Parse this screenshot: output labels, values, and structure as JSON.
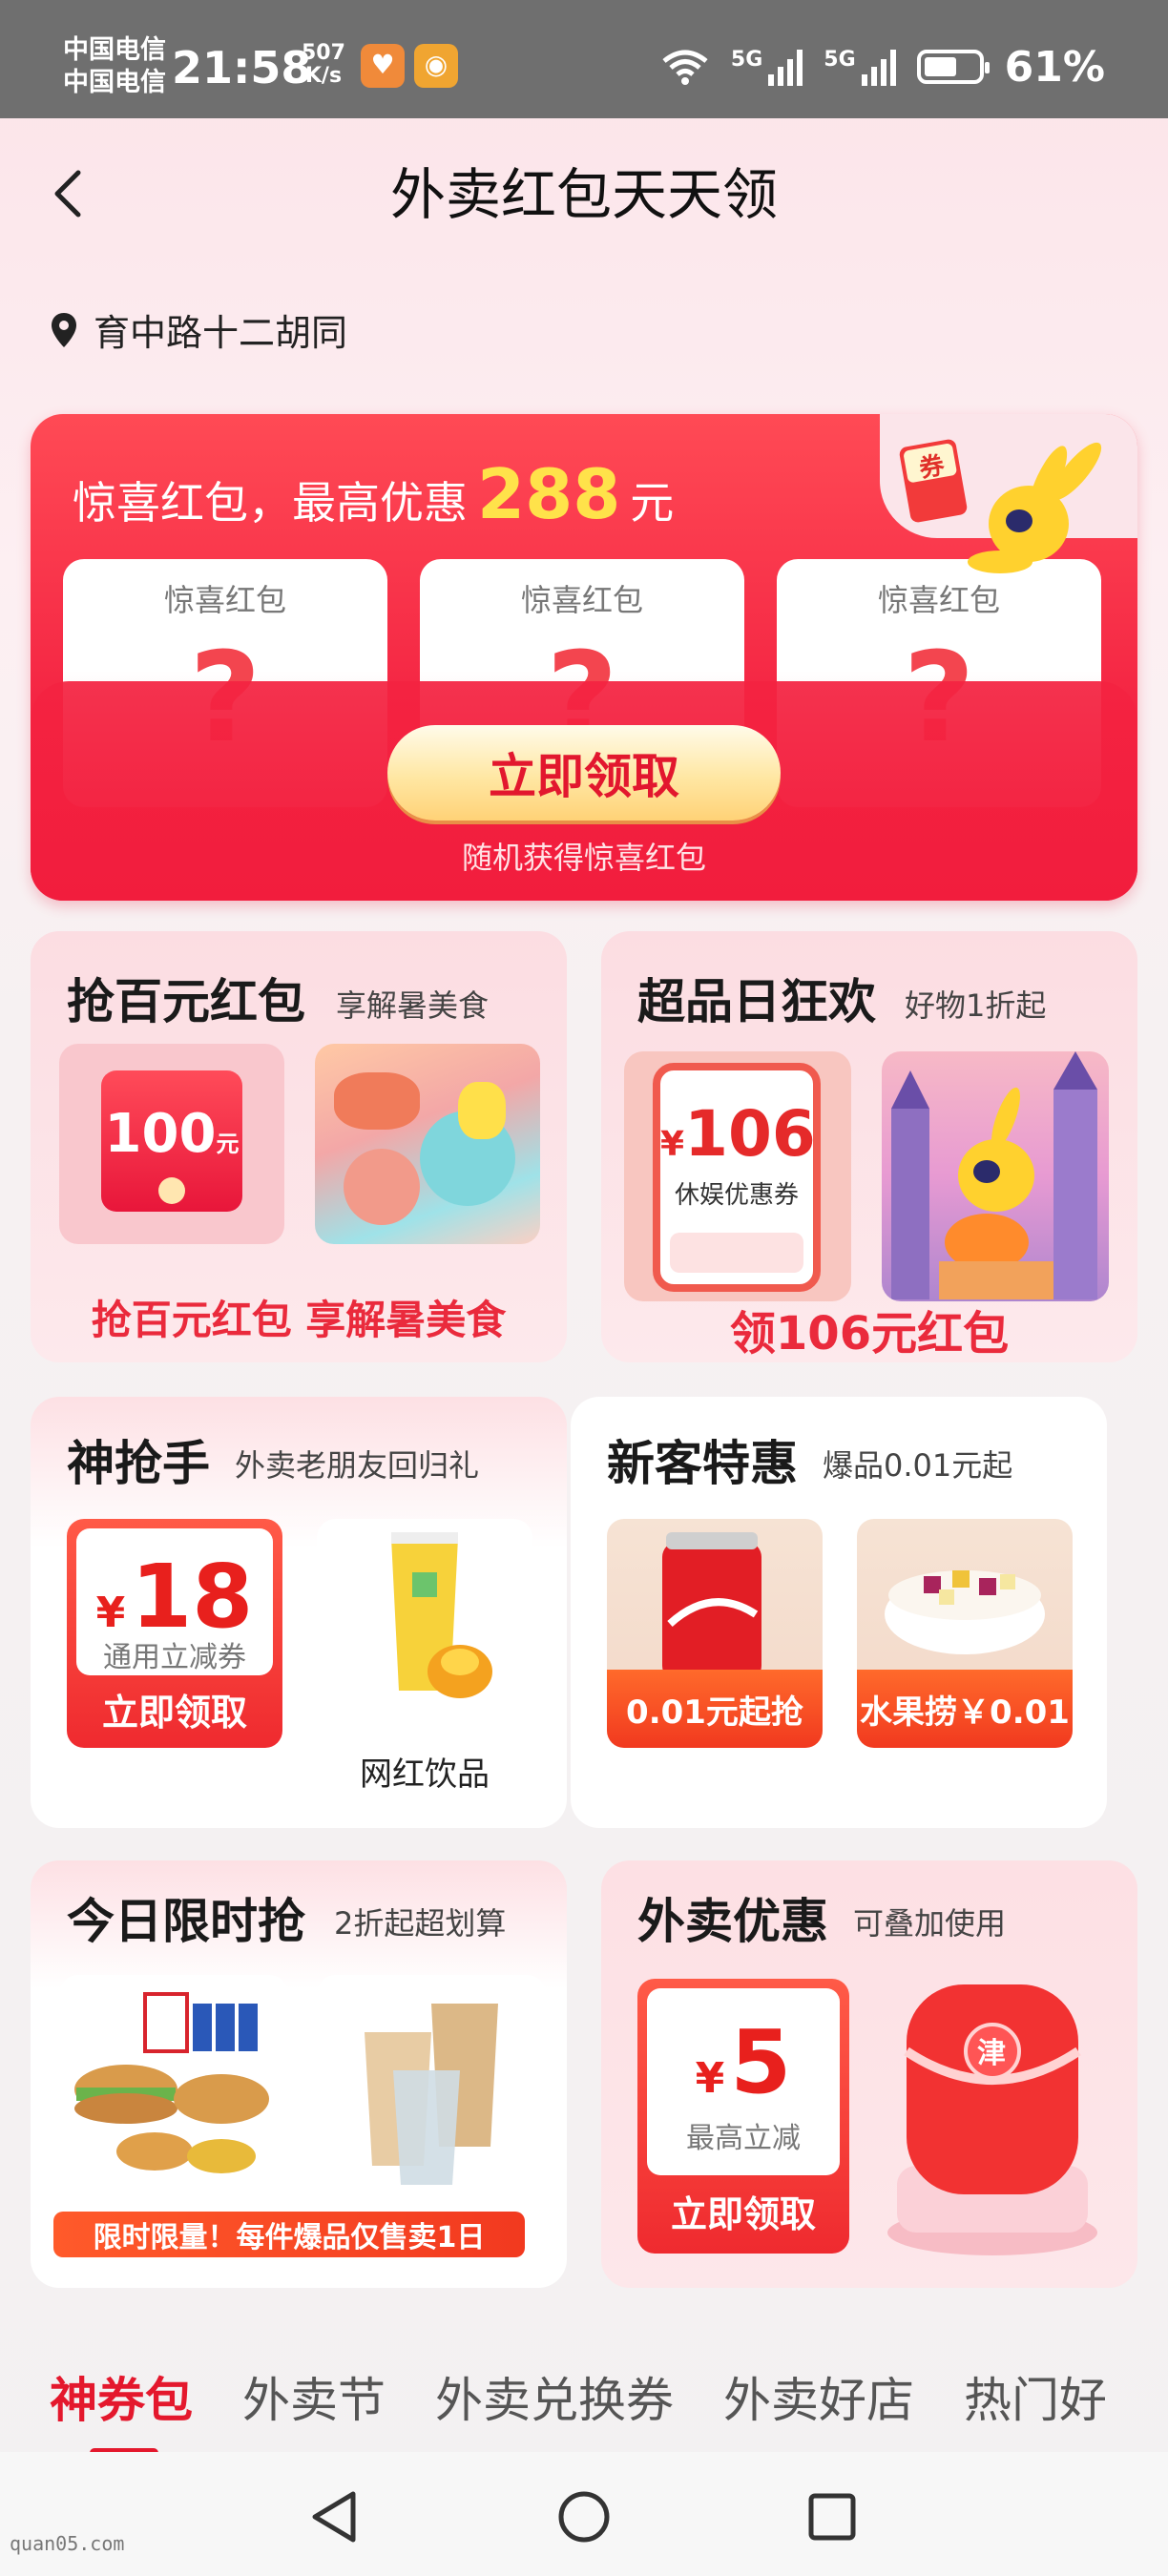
{
  "status_bar": {
    "carrier_1": "中国电信",
    "carrier_2": "中国电信",
    "time": "21:58",
    "net_speed_value": "507",
    "net_speed_unit": "K/s",
    "wifi_label": "6",
    "signal_1_label": "5G",
    "signal_2_label": "5G",
    "battery_percent": "61%",
    "battery_level": 0.61
  },
  "header": {
    "title": "外卖红包天天领"
  },
  "location": {
    "address": "育中路十二胡同"
  },
  "surprise_banner": {
    "title_prefix": "惊喜红包，最高优惠",
    "amount": "288",
    "unit": "元",
    "cards": [
      {
        "label": "惊喜红包",
        "mark": "?"
      },
      {
        "label": "惊喜红包",
        "mark": "?"
      },
      {
        "label": "惊喜红包",
        "mark": "?"
      }
    ],
    "mascot_badge": "券",
    "claim_button": "立即领取",
    "subtitle": "随机获得惊喜红包"
  },
  "tiles": {
    "hundred": {
      "title": "抢百元红包",
      "subtitle": "享解暑美食",
      "packet_value": "100",
      "packet_unit": "元",
      "caption": "抢百元红包 享解暑美食"
    },
    "super_day": {
      "title": "超品日狂欢",
      "subtitle": "好物1折起",
      "coupon_symbol": "¥",
      "coupon_value": "106",
      "coupon_desc": "休娱优惠券",
      "caption": "领106元红包"
    },
    "grabber": {
      "title": "神抢手",
      "subtitle": "外卖老朋友回归礼",
      "coupon_symbol": "¥",
      "coupon_value": "18",
      "coupon_note": "通用立减券",
      "coupon_cta": "立即领取",
      "product_label": "网红饮品"
    },
    "new_customer": {
      "title": "新客特惠",
      "subtitle": "爆品0.01元起",
      "products": [
        {
          "price_label": "0.01元起抢"
        },
        {
          "price_label": "水果捞￥0.01"
        }
      ]
    },
    "flash": {
      "title": "今日限时抢",
      "subtitle": "2折起超划算",
      "ribbon": "限时限量！每件爆品仅售卖1日"
    },
    "delivery_discount": {
      "title": "外卖优惠",
      "subtitle": "可叠加使用",
      "coupon_symbol": "¥",
      "coupon_value": "5",
      "coupon_note": "最高立减",
      "coupon_cta": "立即领取",
      "jar_glyph": "津"
    }
  },
  "tabs": [
    {
      "label": "神券包",
      "active": true
    },
    {
      "label": "外卖节",
      "active": false
    },
    {
      "label": "外卖兑换券",
      "active": false
    },
    {
      "label": "外卖好店",
      "active": false
    },
    {
      "label": "热门好",
      "active": false
    }
  ],
  "watermark": "quan05.com",
  "colors": {
    "accent_red": "#e4182d",
    "gold": "#ffe24a",
    "status_bar": "#6f6f6f"
  },
  "icons": {
    "back": "chevron-left-icon",
    "location": "location-pin-icon",
    "nav_back": "triangle-back-icon",
    "nav_home": "circle-home-icon",
    "nav_recents": "square-recents-icon"
  }
}
